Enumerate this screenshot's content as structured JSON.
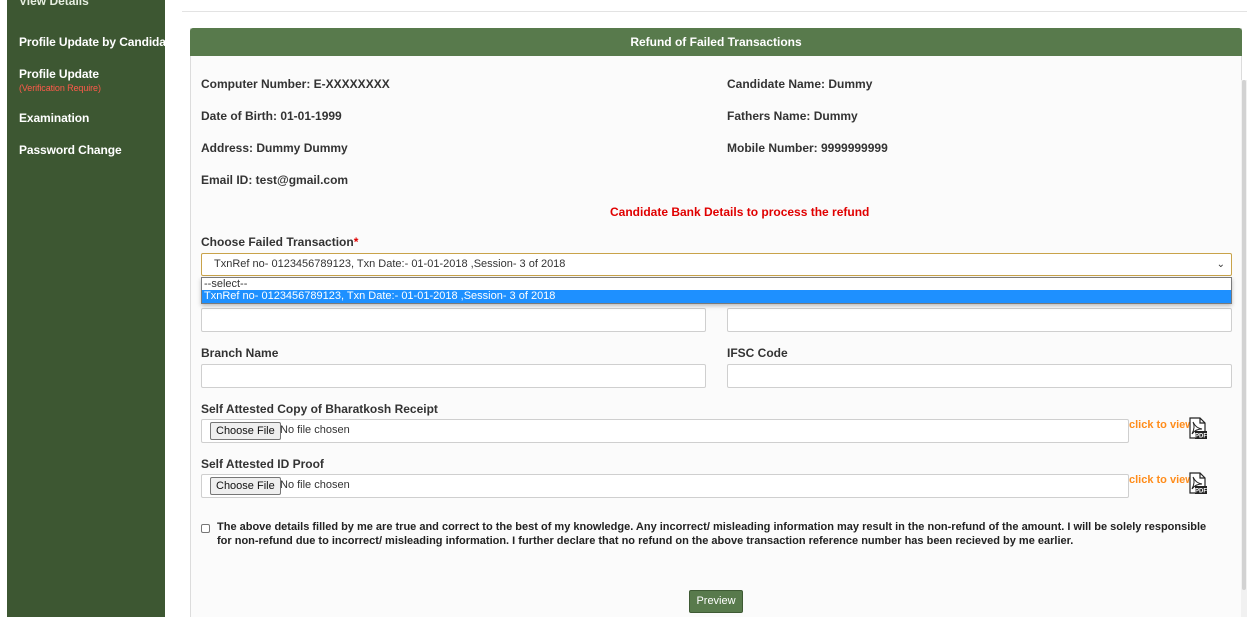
{
  "sidebar": {
    "cut_item": "View Details",
    "items": [
      {
        "label": "Profile Update by Candidates"
      },
      {
        "label": "Profile Update",
        "sub": "(Verification Require)"
      },
      {
        "label": "Examination"
      },
      {
        "label": "Password Change"
      }
    ]
  },
  "panel": {
    "title": "Refund of Failed Transactions"
  },
  "info": {
    "computer_number": "Computer Number: E-XXXXXXXX",
    "candidate_name": "Candidate Name: Dummy",
    "dob": "Date of Birth: 01-01-1999",
    "fathers_name": "Fathers Name: Dummy",
    "address": "Address: Dummy Dummy",
    "mobile": "Mobile Number: 9999999999",
    "email": "Email ID: test@gmail.com"
  },
  "bank_note": "Candidate Bank Details to process the refund",
  "failed_txn": {
    "label": "Choose Failed Transaction",
    "required_mark": "*",
    "selected": "TxnRef no- 0123456789123, Txn Date:- 01-01-2018 ,Session- 3 of 2018",
    "options": [
      "--select--",
      "TxnRef no- 0123456789123, Txn Date:- 01-01-2018 ,Session- 3 of 2018"
    ]
  },
  "fields": {
    "branch_name": "Branch Name",
    "ifsc_code": "IFSC Code"
  },
  "uploads": {
    "receipt_label": "Self Attested Copy of Bharatkosh Receipt",
    "id_proof_label": "Self Attested ID Proof",
    "choose_file": "Choose File",
    "no_file": "No file chosen",
    "click_to_view": "click to view",
    "pdf_icon": "pdf-icon"
  },
  "declaration": "The above details filled by me are true and correct to the best of my knowledge. Any incorrect/ misleading information may result in the non-refund of the amount. I will be solely responsible for non-refund due to incorrect/ misleading information. I further declare that no refund on the above transaction reference number has been recieved by me earlier.",
  "preview_button": "Preview",
  "colors": {
    "sidebar": "#3d5732",
    "header": "#587a4c",
    "highlight": "#1e90ff",
    "note_red": "#e00000",
    "link_orange": "#ff8c1a"
  }
}
